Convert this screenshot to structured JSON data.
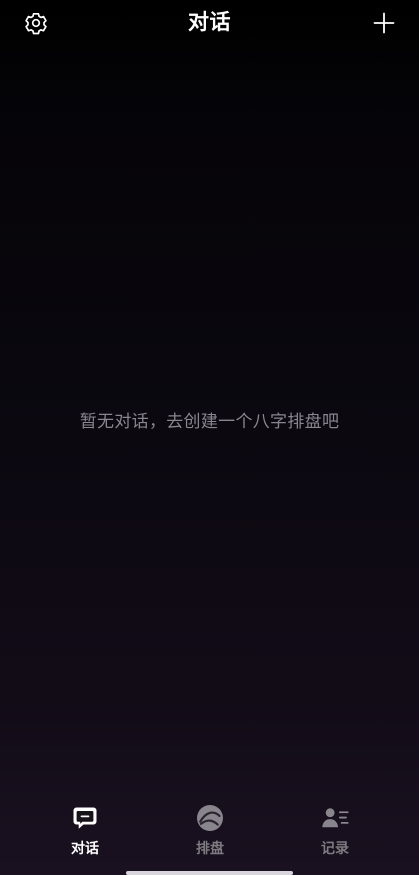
{
  "header": {
    "title": "对话",
    "left_icon": "settings-icon",
    "right_icon": "plus-icon"
  },
  "main": {
    "empty_message": "暂无对话，去创建一个八字排盘吧"
  },
  "tabbar": {
    "tabs": [
      {
        "label": "对话",
        "icon": "chat-icon",
        "active": true
      },
      {
        "label": "排盘",
        "icon": "yin-yang-icon",
        "active": false
      },
      {
        "label": "记录",
        "icon": "person-list-icon",
        "active": false
      }
    ]
  },
  "colors": {
    "background_top": "#000000",
    "background_bottom": "#1a1120",
    "text_primary": "#ffffff",
    "text_muted": "#8a8690",
    "tab_inactive": "#7d7a80"
  }
}
